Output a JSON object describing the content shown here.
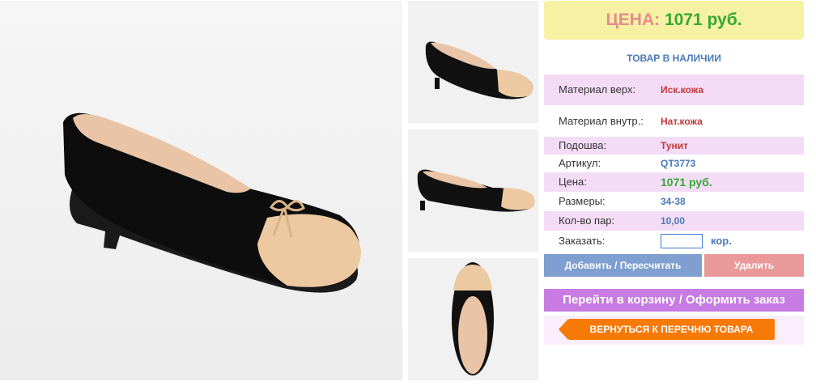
{
  "price_banner": {
    "label": "ЦЕНА:",
    "value": "1071 руб."
  },
  "stock_status": "ТОВАР В НАЛИЧИИ",
  "specs": [
    {
      "key": "Материал верх:",
      "value": "Иск.кожа",
      "color": "#c0393b"
    },
    {
      "key": "Материал внутр.:",
      "value": "Нат.кожа",
      "color": "#c0393b"
    },
    {
      "key": "Подошва:",
      "value": "Тунит",
      "color": "#c0393b"
    },
    {
      "key": "Артикул:",
      "value": "QT3773",
      "color": "#4a7ab8"
    },
    {
      "key": "Цена:",
      "value": "1071 руб.",
      "color": "#33aa33"
    },
    {
      "key": "Размеры:",
      "value": "34-38",
      "color": "#4a7ab8"
    },
    {
      "key": "Кол-во пар:",
      "value": "10,00",
      "color": "#4a7ab8"
    }
  ],
  "order": {
    "label": "Заказать:",
    "input_value": "",
    "unit": "кор."
  },
  "buttons": {
    "add": "Добавить / Пересчитать",
    "delete": "Удалить",
    "cart": "Перейти в корзину / Оформить заказ",
    "back": "ВЕРНУТЬСЯ К ПЕРЕЧНЮ ТОВАРА"
  },
  "colors": {
    "price_bg": "#f7f1a4",
    "price_label": "#e58c8c",
    "price_value": "#33aa33",
    "row_highlight": "#f4dcf6",
    "add_button": "#7e9fd0",
    "delete_button": "#e99999",
    "cart_button": "#c77be3",
    "back_button": "#f77a08"
  }
}
